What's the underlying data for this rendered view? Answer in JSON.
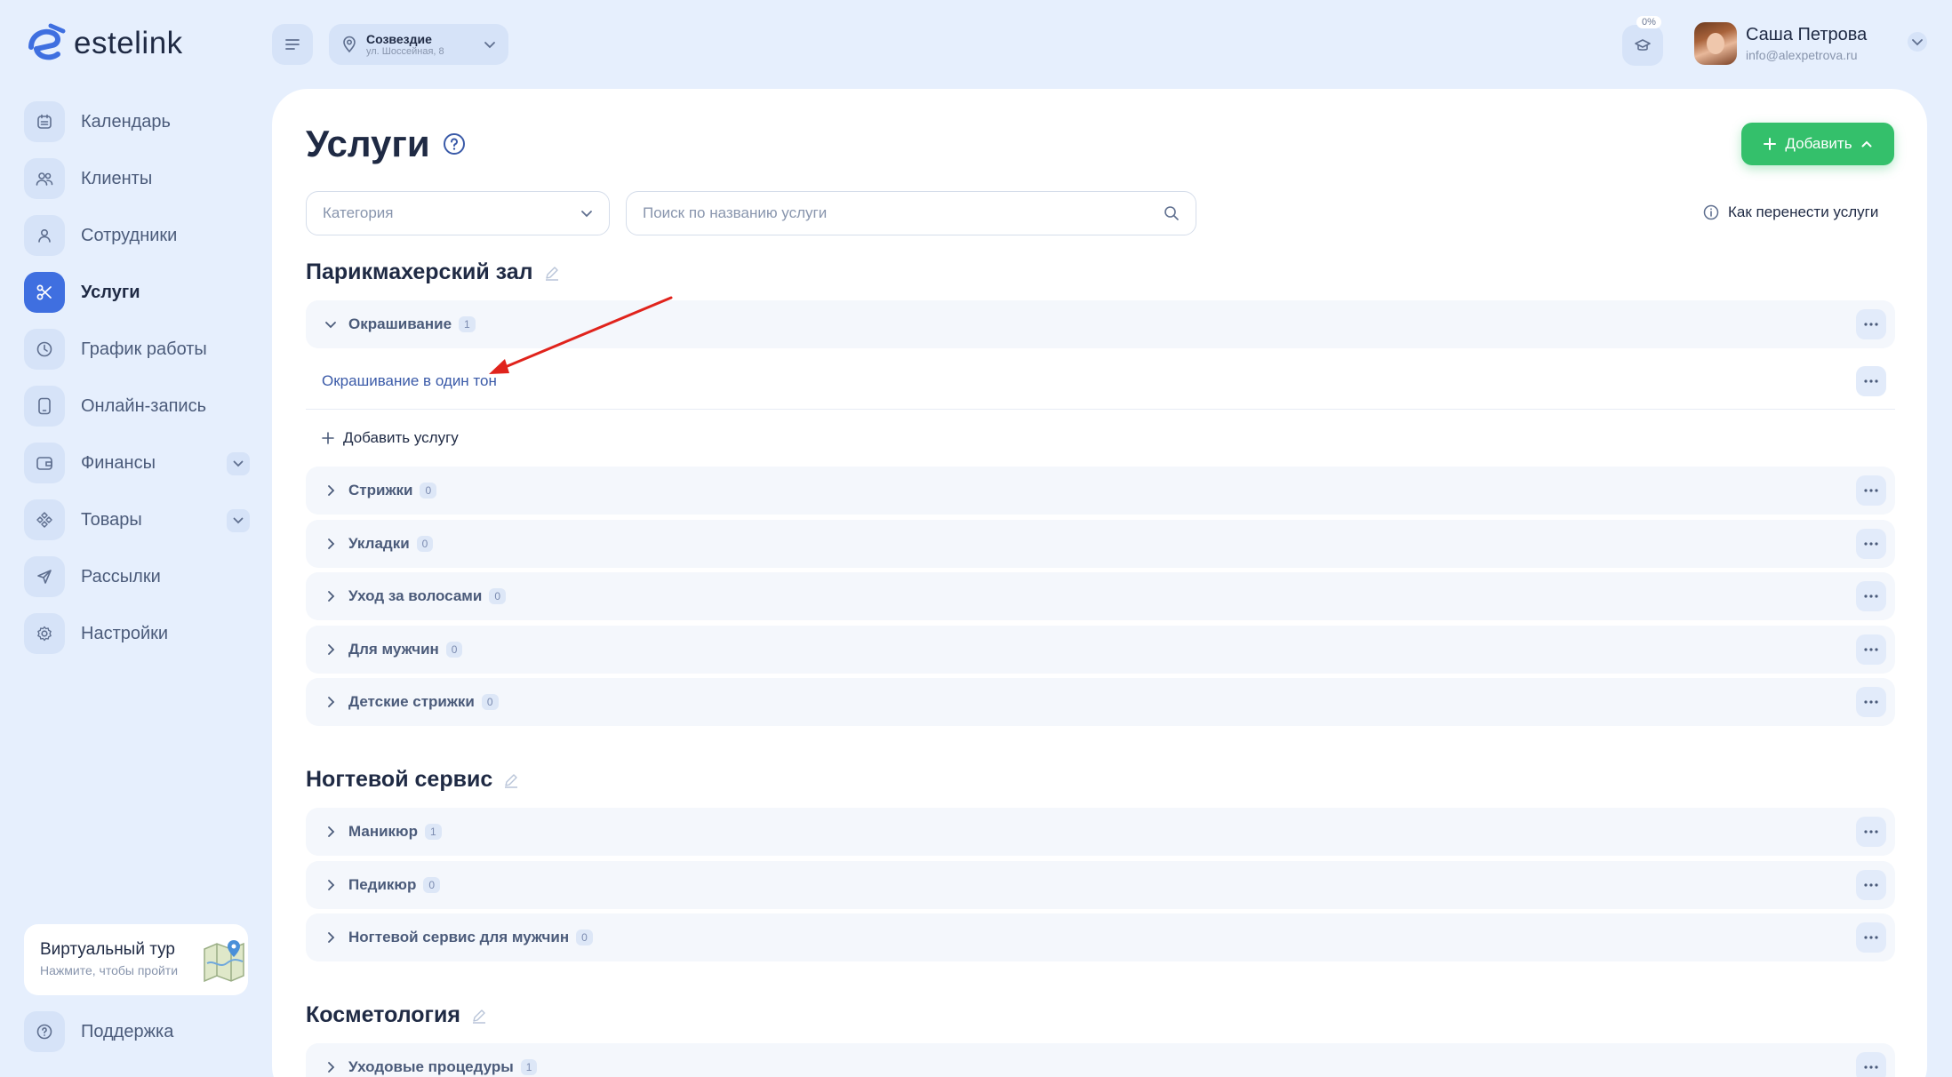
{
  "app": {
    "logo_text": "estelink"
  },
  "header": {
    "location_name": "Созвездие",
    "location_address": "ул. Шоссейная, 8",
    "progress_badge": "0%",
    "user_name": "Саша Петрова",
    "user_email": "info@alexpetrova.ru"
  },
  "sidebar": {
    "items": [
      {
        "label": "Календарь",
        "icon": "calendar-icon"
      },
      {
        "label": "Клиенты",
        "icon": "clients-icon"
      },
      {
        "label": "Сотрудники",
        "icon": "employee-icon"
      },
      {
        "label": "Услуги",
        "icon": "scissors-icon",
        "active": true
      },
      {
        "label": "График работы",
        "icon": "clock-icon"
      },
      {
        "label": "Онлайн-запись",
        "icon": "phone-icon"
      },
      {
        "label": "Финансы",
        "icon": "wallet-icon",
        "expandable": true
      },
      {
        "label": "Товары",
        "icon": "products-icon",
        "expandable": true
      },
      {
        "label": "Рассылки",
        "icon": "send-icon"
      },
      {
        "label": "Настройки",
        "icon": "gear-icon"
      }
    ],
    "tour_title": "Виртуальный тур",
    "tour_subtitle": "Нажмите, чтобы пройти",
    "support_label": "Поддержка"
  },
  "main": {
    "title": "Услуги",
    "add_button": "Добавить",
    "category_placeholder": "Категория",
    "search_placeholder": "Поиск по названию услуги",
    "transfer_link": "Как перенести услуги",
    "add_service": "Добавить услугу",
    "sections": [
      {
        "title": "Парикмахерский зал",
        "categories": [
          {
            "label": "Окрашивание",
            "count": "1",
            "expanded": true
          },
          {
            "label": "Стрижки",
            "count": "0"
          },
          {
            "label": "Укладки",
            "count": "0"
          },
          {
            "label": "Уход за волосами",
            "count": "0"
          },
          {
            "label": "Для мужчин",
            "count": "0"
          },
          {
            "label": "Детские стрижки",
            "count": "0"
          }
        ],
        "services": [
          "Окрашивание в один тон"
        ]
      },
      {
        "title": "Ногтевой сервис",
        "categories": [
          {
            "label": "Маникюр",
            "count": "1"
          },
          {
            "label": "Педикюр",
            "count": "0"
          },
          {
            "label": "Ногтевой сервис для мужчин",
            "count": "0"
          }
        ]
      },
      {
        "title": "Косметология",
        "categories": [
          {
            "label": "Уходовые процедуры",
            "count": "1"
          }
        ]
      }
    ]
  },
  "colors": {
    "background": "#e6effd",
    "accent": "#3f6fe0",
    "add_button": "#34c06b",
    "annotation_arrow": "#e0231c"
  }
}
